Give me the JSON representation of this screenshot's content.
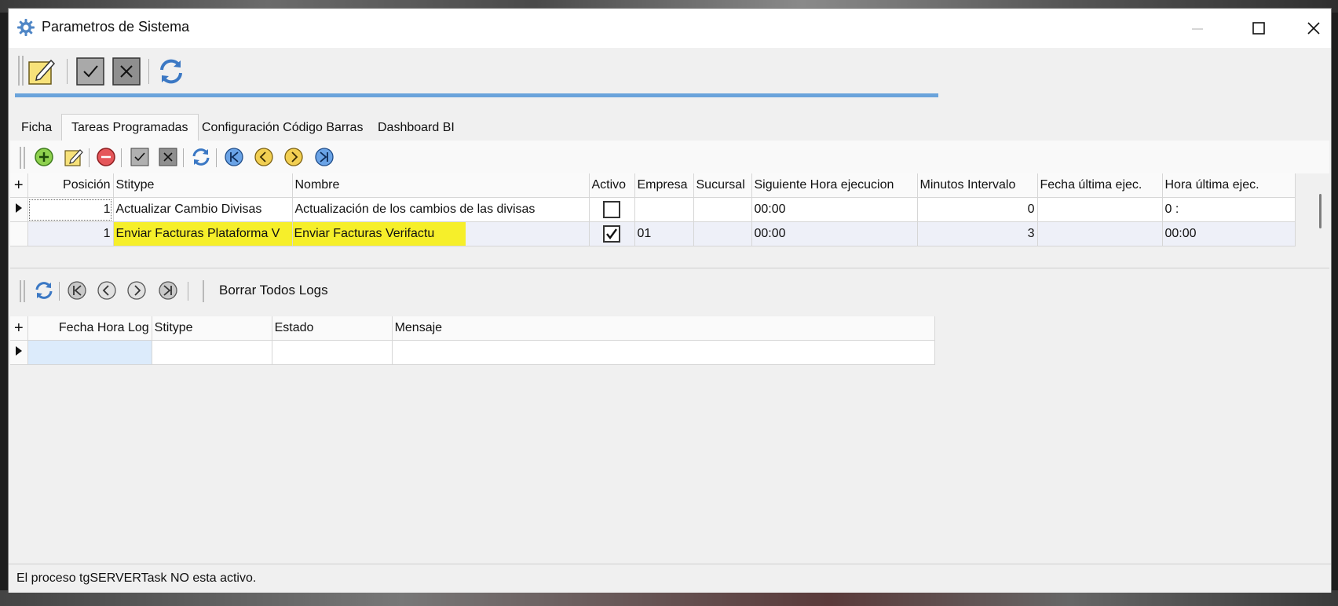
{
  "window": {
    "title": "Parametros de Sistema"
  },
  "colors": {
    "accent": "#6aa3db",
    "highlight": "#f6ef2a",
    "background": "#f0f0f0"
  },
  "main_toolbar": {
    "icons": [
      "edit-icon",
      "confirm-icon",
      "cancel-icon",
      "refresh-icon"
    ],
    "progress_fraction": 0.7
  },
  "tabs": [
    {
      "label": "Ficha",
      "active": false
    },
    {
      "label": "Tareas Programadas",
      "active": true
    },
    {
      "label": "Configuración Código Barras",
      "active": false
    },
    {
      "label": "Dashboard BI",
      "active": false
    }
  ],
  "task_toolbar": {
    "icons": [
      "add-icon",
      "edit-icon",
      "delete-icon",
      "confirm-icon",
      "cancel-icon",
      "refresh-icon",
      "first-icon",
      "prev-icon",
      "next-icon",
      "last-icon"
    ]
  },
  "tasks_grid": {
    "columns": [
      "Posición",
      "Stitype",
      "Nombre",
      "Activo",
      "Empresa",
      "Sucursal",
      "Siguiente Hora ejecucion",
      "Minutos Intervalo",
      "Fecha última ejec.",
      "Hora última ejec."
    ],
    "rows": [
      {
        "posicion": "1",
        "stitype": "Actualizar Cambio Divisas",
        "nombre": "Actualización de los cambios de las divisas",
        "activo": false,
        "empresa": "",
        "sucursal": "",
        "siguiente": "00:00",
        "minutos": "0",
        "fecha": "",
        "hora": "0 :"
      },
      {
        "posicion": "1",
        "stitype": "Enviar Facturas Plataforma V",
        "nombre": "Enviar Facturas Verifactu",
        "activo": true,
        "empresa": "01",
        "sucursal": "",
        "siguiente": "00:00",
        "minutos": "3",
        "fecha": "",
        "hora": "00:00"
      }
    ]
  },
  "log_toolbar": {
    "delete_all_label": "Borrar Todos Logs"
  },
  "log_grid": {
    "columns": [
      "Fecha Hora Log",
      "Stitype",
      "Estado",
      "Mensaje"
    ]
  },
  "status": {
    "message": "El proceso tgSERVERTask NO esta activo."
  }
}
